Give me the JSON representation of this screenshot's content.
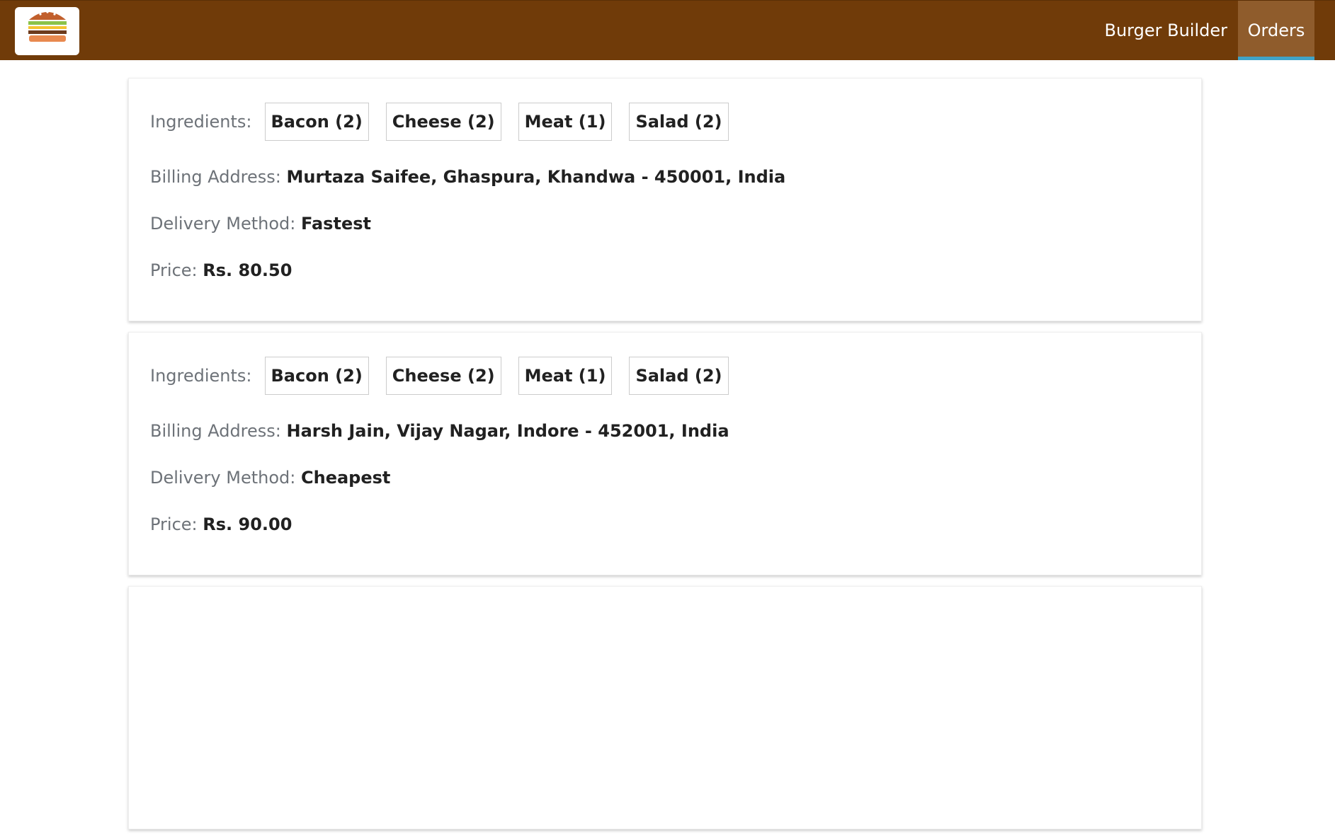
{
  "header": {
    "nav": [
      {
        "label": "Burger Builder",
        "active": false
      },
      {
        "label": "Orders",
        "active": true
      }
    ],
    "colors": {
      "toolbar": "#703b09",
      "active_item": "#8f5c2c",
      "active_underline": "#40a4c8"
    }
  },
  "labels": {
    "ingredients": "Ingredients:",
    "billing": "Billing Address:",
    "delivery": "Delivery Method:",
    "price": "Price:"
  },
  "orders": [
    {
      "ingredients": [
        "Bacon (2)",
        "Cheese (2)",
        "Meat (1)",
        "Salad (2)"
      ],
      "address": "Murtaza Saifee, Ghaspura, Khandwa - 450001, India",
      "delivery": "Fastest",
      "price": "Rs. 80.50"
    },
    {
      "ingredients": [
        "Bacon (2)",
        "Cheese (2)",
        "Meat (1)",
        "Salad (2)"
      ],
      "address": "Harsh Jain, Vijay Nagar, Indore - 452001, India",
      "delivery": "Cheapest",
      "price": "Rs. 90.00"
    },
    {
      "ingredients": [],
      "address": "",
      "delivery": "",
      "price": ""
    }
  ]
}
